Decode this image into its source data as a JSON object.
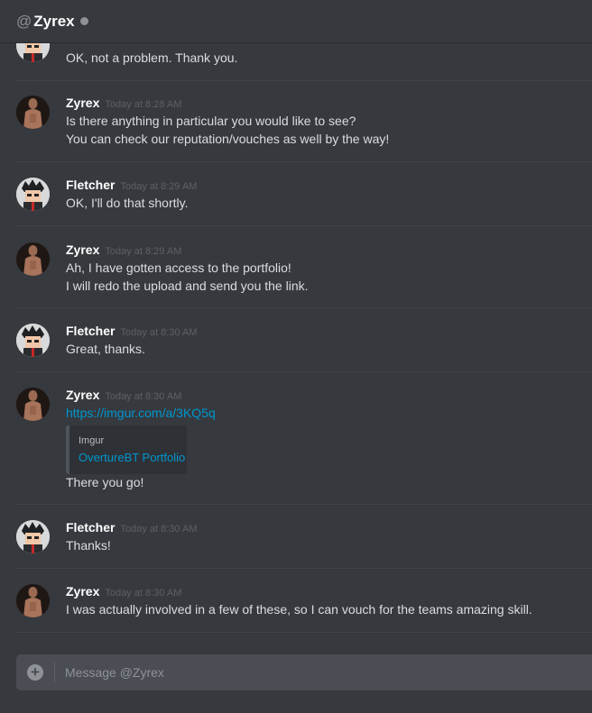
{
  "header": {
    "at": "@",
    "username": "Zyrex"
  },
  "messages": [
    {
      "author": "",
      "time": "",
      "lines": [
        "OK, not a problem. Thank you."
      ]
    },
    {
      "author": "Zyrex",
      "time": "Today at 8:28 AM",
      "lines": [
        "Is there anything in particular you would like to see?",
        "You can check our reputation/vouches as well by the way!"
      ]
    },
    {
      "author": "Fletcher",
      "time": "Today at 8:29 AM",
      "lines": [
        "OK, I'll do that shortly."
      ]
    },
    {
      "author": "Zyrex",
      "time": "Today at 8:29 AM",
      "lines": [
        "Ah, I have gotten access to the portfolio!",
        "I will redo the upload and send you the link."
      ]
    },
    {
      "author": "Fletcher",
      "time": "Today at 8:30 AM",
      "lines": [
        "Great, thanks."
      ]
    },
    {
      "author": "Zyrex",
      "time": "Today at 8:30 AM",
      "link": "https://imgur.com/a/3KQ5q",
      "embed": {
        "provider": "Imgur",
        "title": "OvertureBT Portfolio"
      },
      "lines": [
        "There you go!"
      ]
    },
    {
      "author": "Fletcher",
      "time": "Today at 8:30 AM",
      "lines": [
        "Thanks!"
      ]
    },
    {
      "author": "Zyrex",
      "time": "Today at 8:30 AM",
      "lines": [
        "I was actually involved in a few of these, so I can vouch for the teams amazing skill."
      ]
    }
  ],
  "composer": {
    "placeholder": "Message @Zyrex"
  },
  "colors": {
    "background": "#36393e",
    "link": "#0096cf",
    "composer": "#4a4d54"
  },
  "icons": [
    "zyrex-avatar",
    "fletcher-avatar",
    "add-attachment-icon",
    "status-dot"
  ]
}
